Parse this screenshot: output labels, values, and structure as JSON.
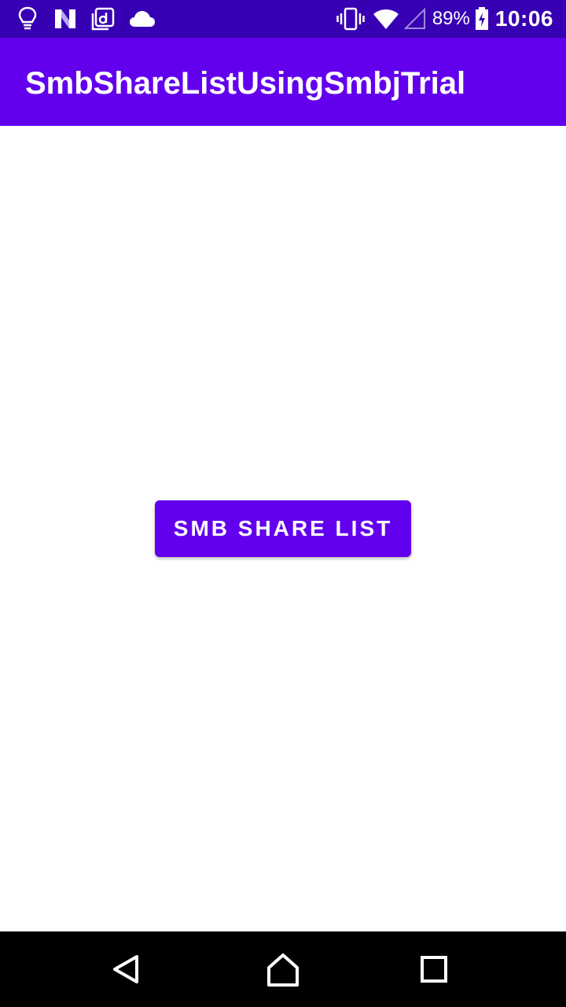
{
  "status_bar": {
    "left_icons": [
      "lightbulb-icon",
      "n-logo-icon",
      "d-app-icon",
      "cloud-icon"
    ],
    "right_icons": [
      "vibrate-icon",
      "wifi-icon",
      "signal-icon",
      "battery-icon"
    ],
    "battery_percent": "89%",
    "time": "10:06"
  },
  "app_bar": {
    "title": "SmbShareListUsingSmbjTrial"
  },
  "main": {
    "button_label": "SMB SHARE LIST"
  },
  "nav_bar": {
    "buttons": [
      "back-icon",
      "home-icon",
      "recents-icon"
    ]
  },
  "colors": {
    "status_bar": "#3700B3",
    "primary": "#6200EE",
    "on_primary": "#FFFFFF",
    "background": "#FFFFFF",
    "nav_bar": "#000000"
  }
}
